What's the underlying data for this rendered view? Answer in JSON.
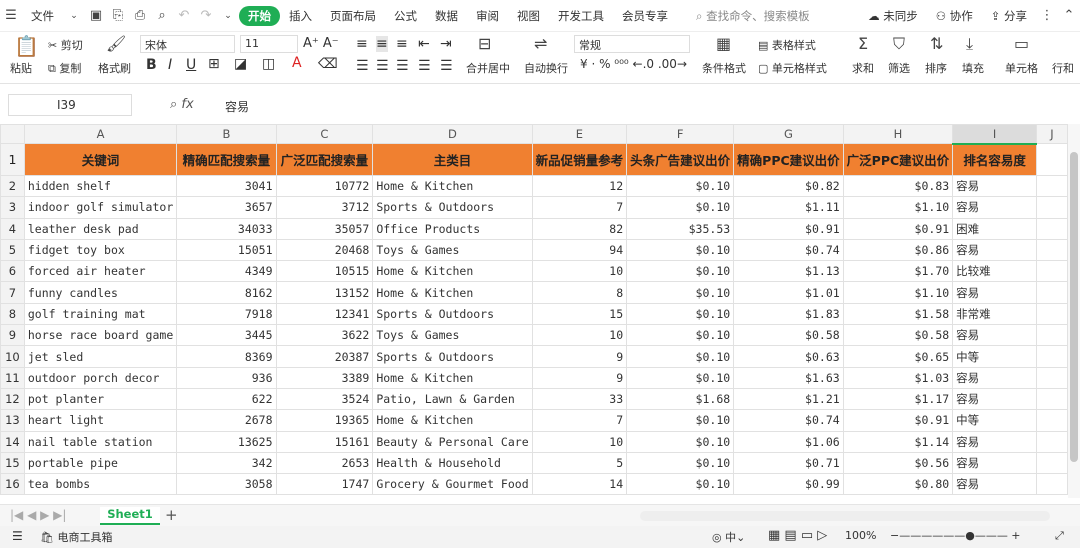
{
  "menubar": {
    "file": "文件",
    "tabs": [
      "开始",
      "插入",
      "页面布局",
      "公式",
      "数据",
      "审阅",
      "视图",
      "开发工具",
      "会员专享"
    ],
    "search": "查找命令、搜索模板",
    "sync": "未同步",
    "collab": "协作",
    "share": "分享"
  },
  "ribbon": {
    "paste": "粘贴",
    "cut": "剪切",
    "copy": "复制",
    "format_painter": "格式刷",
    "font_name": "宋体",
    "font_size": "11",
    "merge": "合并居中",
    "wrap": "自动换行",
    "number_format": "常规",
    "conditional": "条件格式",
    "table_style": "表格样式",
    "cell_style": "单元格样式",
    "sum": "求和",
    "filter": "筛选",
    "sort": "排序",
    "fill": "填充",
    "cell": "单元格",
    "rowcol": "行和"
  },
  "formula": {
    "cell_ref": "I39",
    "value": "容易"
  },
  "columns": [
    "A",
    "B",
    "C",
    "D",
    "E",
    "F",
    "G",
    "H",
    "I",
    "J"
  ],
  "headers": [
    "关键词",
    "精确匹配搜索量",
    "广泛匹配搜索量",
    "主类目",
    "新品促销量参考",
    "头条广告建议出价",
    "精确PPC建议出价",
    "广泛PPC建议出价",
    "排名容易度"
  ],
  "rows": [
    [
      "hidden shelf",
      "3041",
      "10772",
      "Home & Kitchen",
      "12",
      "$0.10",
      "$0.82",
      "$0.83",
      "容易"
    ],
    [
      "indoor golf simulator",
      "3657",
      "3712",
      "Sports & Outdoors",
      "7",
      "$0.10",
      "$1.11",
      "$1.10",
      "容易"
    ],
    [
      "leather desk pad",
      "34033",
      "35057",
      "Office Products",
      "82",
      "$35.53",
      "$0.91",
      "$0.91",
      "困难"
    ],
    [
      "fidget toy box",
      "15051",
      "20468",
      "Toys & Games",
      "94",
      "$0.10",
      "$0.74",
      "$0.86",
      "容易"
    ],
    [
      "forced air heater",
      "4349",
      "10515",
      "Home & Kitchen",
      "10",
      "$0.10",
      "$1.13",
      "$1.70",
      "比较难"
    ],
    [
      "funny candles",
      "8162",
      "13152",
      "Home & Kitchen",
      "8",
      "$0.10",
      "$1.01",
      "$1.10",
      "容易"
    ],
    [
      "golf training mat",
      "7918",
      "12341",
      "Sports & Outdoors",
      "15",
      "$0.10",
      "$1.83",
      "$1.58",
      "非常难"
    ],
    [
      "horse race board game",
      "3445",
      "3622",
      "Toys & Games",
      "10",
      "$0.10",
      "$0.58",
      "$0.58",
      "容易"
    ],
    [
      "jet sled",
      "8369",
      "20387",
      "Sports & Outdoors",
      "9",
      "$0.10",
      "$0.63",
      "$0.65",
      "中等"
    ],
    [
      "outdoor porch decor",
      "936",
      "3389",
      "Home & Kitchen",
      "9",
      "$0.10",
      "$1.63",
      "$1.03",
      "容易"
    ],
    [
      "pot planter",
      "622",
      "3524",
      "Patio, Lawn & Garden",
      "33",
      "$1.68",
      "$1.21",
      "$1.17",
      "容易"
    ],
    [
      "heart light",
      "2678",
      "19365",
      "Home & Kitchen",
      "7",
      "$0.10",
      "$0.74",
      "$0.91",
      "中等"
    ],
    [
      "nail table station",
      "13625",
      "15161",
      "Beauty & Personal Care",
      "10",
      "$0.10",
      "$1.06",
      "$1.14",
      "容易"
    ],
    [
      "portable pipe",
      "342",
      "2653",
      "Health & Household",
      "5",
      "$0.10",
      "$0.71",
      "$0.56",
      "容易"
    ],
    [
      "tea bombs",
      "3058",
      "1747",
      "Grocery & Gourmet Food",
      "14",
      "$0.10",
      "$0.99",
      "$0.80",
      "容易"
    ]
  ],
  "sheetbar": {
    "tab": "Sheet1"
  },
  "statusbar": {
    "toolbox": "电商工具箱",
    "zoom": "100%"
  },
  "colors": {
    "header_fill": "#f08030",
    "accent": "#1fae55"
  }
}
